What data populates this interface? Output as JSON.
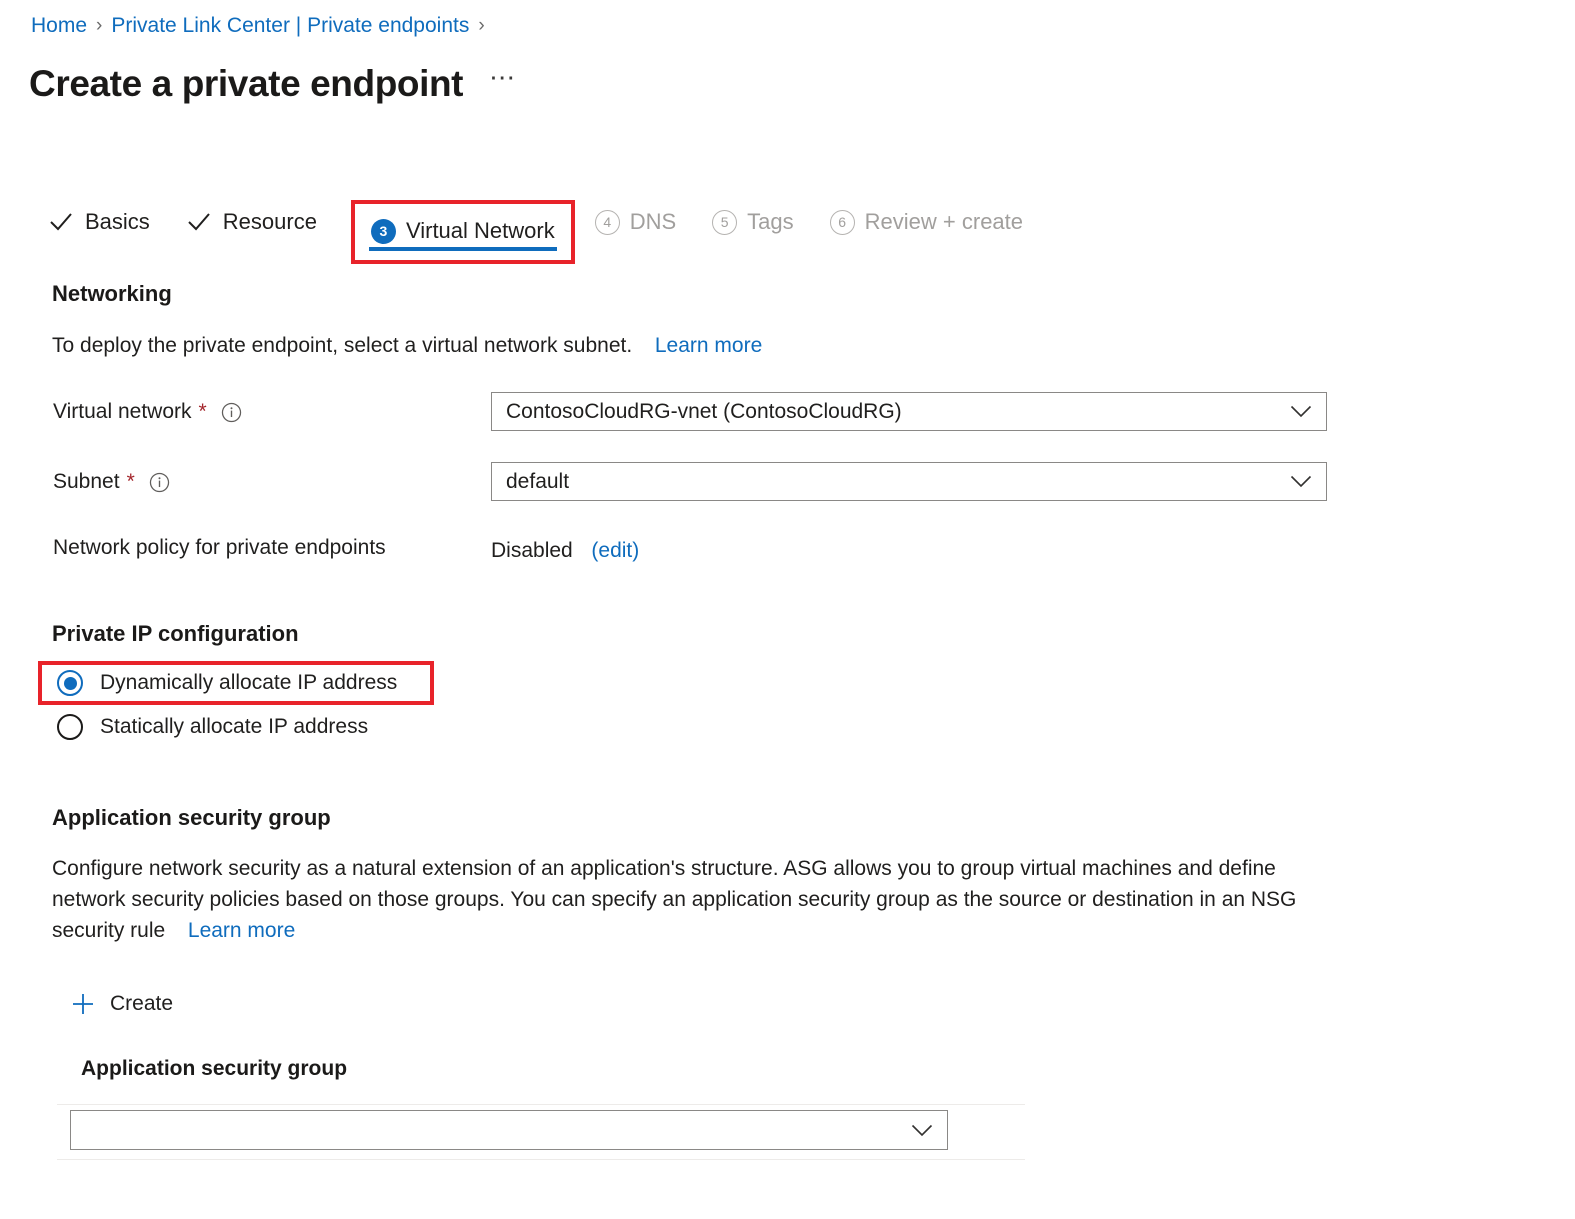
{
  "breadcrumb": {
    "items": [
      {
        "label": "Home"
      },
      {
        "label": "Private Link Center | Private endpoints"
      }
    ],
    "separator": "›"
  },
  "header": {
    "title": "Create a private endpoint",
    "more_actions": "⋯"
  },
  "wizard": {
    "tabs": [
      {
        "label": "Basics",
        "state": "completed",
        "marker": "check"
      },
      {
        "label": "Resource",
        "state": "completed",
        "marker": "check"
      },
      {
        "label": "Virtual Network",
        "state": "active",
        "marker": "3"
      },
      {
        "label": "DNS",
        "state": "disabled",
        "marker": "4"
      },
      {
        "label": "Tags",
        "state": "disabled",
        "marker": "5"
      },
      {
        "label": "Review + create",
        "state": "disabled",
        "marker": "6"
      }
    ]
  },
  "networking": {
    "heading": "Networking",
    "description": "To deploy the private endpoint, select a virtual network subnet.",
    "learn_more": "Learn more",
    "virtual_network": {
      "label": "Virtual network",
      "required_mark": "*",
      "info_icon": "info-icon",
      "value": "ContosoCloudRG-vnet (ContosoCloudRG)"
    },
    "subnet": {
      "label": "Subnet",
      "required_mark": "*",
      "info_icon": "info-icon",
      "value": "default"
    },
    "network_policy": {
      "label": "Network policy for private endpoints",
      "value": "Disabled",
      "edit_link": "(edit)"
    }
  },
  "private_ip": {
    "heading": "Private IP configuration",
    "options": [
      {
        "label": "Dynamically allocate IP address",
        "selected": true
      },
      {
        "label": "Statically allocate IP address",
        "selected": false
      }
    ]
  },
  "asg": {
    "heading": "Application security group",
    "description": "Configure network security as a natural extension of an application's structure. ASG allows you to group virtual machines and define network security policies based on those groups. You can specify an application security group as the source or destination in an NSG security rule",
    "learn_more": "Learn more",
    "create_label": "Create",
    "create_icon": "plus-icon",
    "field_label": "Application security group",
    "field_value": ""
  },
  "colors": {
    "accent_blue": "#0f6cbd",
    "annotation_red": "#e8232a",
    "required_red": "#a4262c",
    "disabled_gray": "#a19f9d",
    "text": "#201f1e"
  }
}
